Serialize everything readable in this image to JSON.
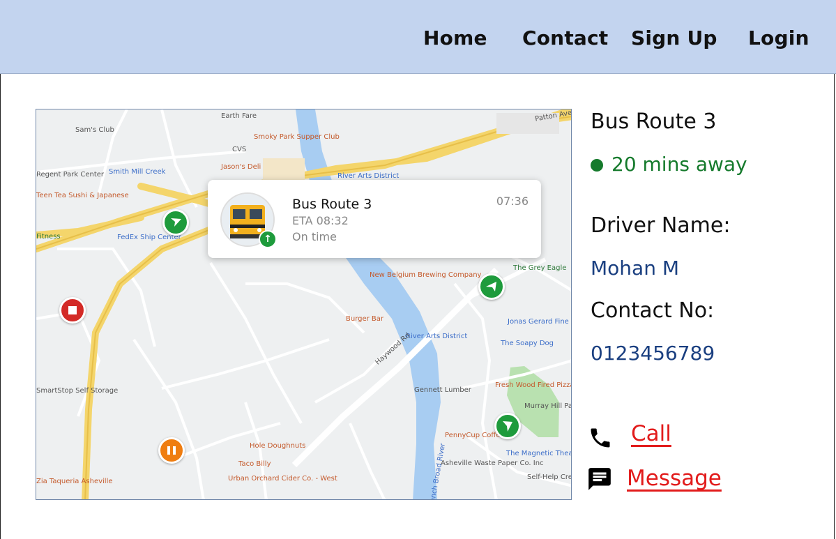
{
  "nav": {
    "items": [
      {
        "label": "Home"
      },
      {
        "label": "Contact"
      },
      {
        "label": "Sign Up"
      },
      {
        "label": "Login"
      }
    ]
  },
  "map": {
    "popup": {
      "title": "Bus Route 3",
      "eta": "ETA 08:32",
      "status": "On time",
      "time": "07:36"
    },
    "labels": [
      "Earth Fare",
      "Sam's Club",
      "Smoky Park Supper Club",
      "CVS",
      "Jason's Deli",
      "River Arts District",
      "Regent Park Center",
      "Smith Mill Creek",
      "Teen Tea Sushi & Japanese",
      "Fitness",
      "FedEx Ship Center",
      "The Grey Eagle",
      "New Belgium Brewing Company",
      "Burger Bar",
      "River Arts District",
      "Jonas Gerard Fine",
      "The Soapy Dog",
      "SmartStop Self Storage",
      "Gennett Lumber",
      "Fresh Wood Fired Pizza West",
      "Murray Hill Park",
      "PennyCup Coffee",
      "Hole Doughnuts",
      "Taco Billy",
      "Urban Orchard Cider Co. - West",
      "Asheville Waste Paper Co. Inc",
      "The Magnetic Theatre",
      "Zia Taqueria Asheville",
      "Self-Help Credit",
      "Haywood Rd",
      "French Broad River",
      "Patton Ave"
    ]
  },
  "details": {
    "route_title": "Bus Route 3",
    "status": "20 mins away",
    "driver_label": "Driver Name:",
    "driver_name": "Mohan M",
    "contact_label": "Contact No:",
    "contact_number": "0123456789",
    "call_label": "Call",
    "message_label": "Message"
  },
  "colors": {
    "nav_bg": "#c3d4ef",
    "status_green": "#157a2c",
    "link_red": "#e21b1b",
    "value_blue": "#1a3f80"
  }
}
